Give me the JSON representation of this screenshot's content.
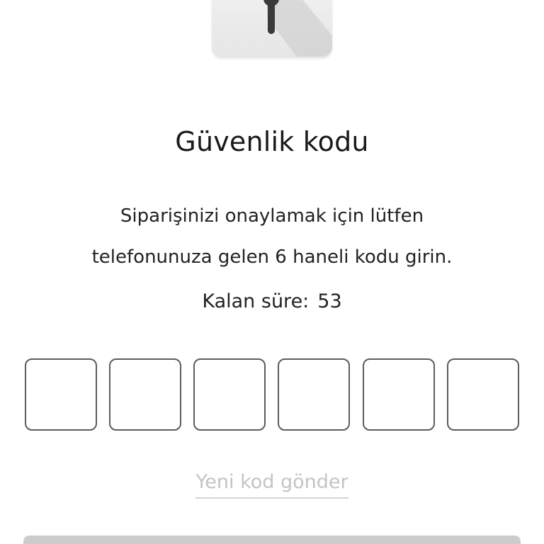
{
  "header": {
    "icon": "keyhole-lock-icon"
  },
  "title": "Güvenlik kodu",
  "description": {
    "line1": "Siparişinizi onaylamak için lütfen",
    "line2": "telefonunuza gelen 6 haneli kodu girin."
  },
  "timer": {
    "label": "Kalan süre:",
    "value": "53"
  },
  "code_inputs": {
    "count": 6,
    "values": [
      "",
      "",
      "",
      "",
      "",
      ""
    ]
  },
  "resend": {
    "label": "Yeni kod gönder",
    "state": "disabled"
  },
  "colors": {
    "input_border": "#5c5c5c",
    "resend_disabled": "#c4c4c4",
    "submit_disabled": "#cccccc"
  }
}
